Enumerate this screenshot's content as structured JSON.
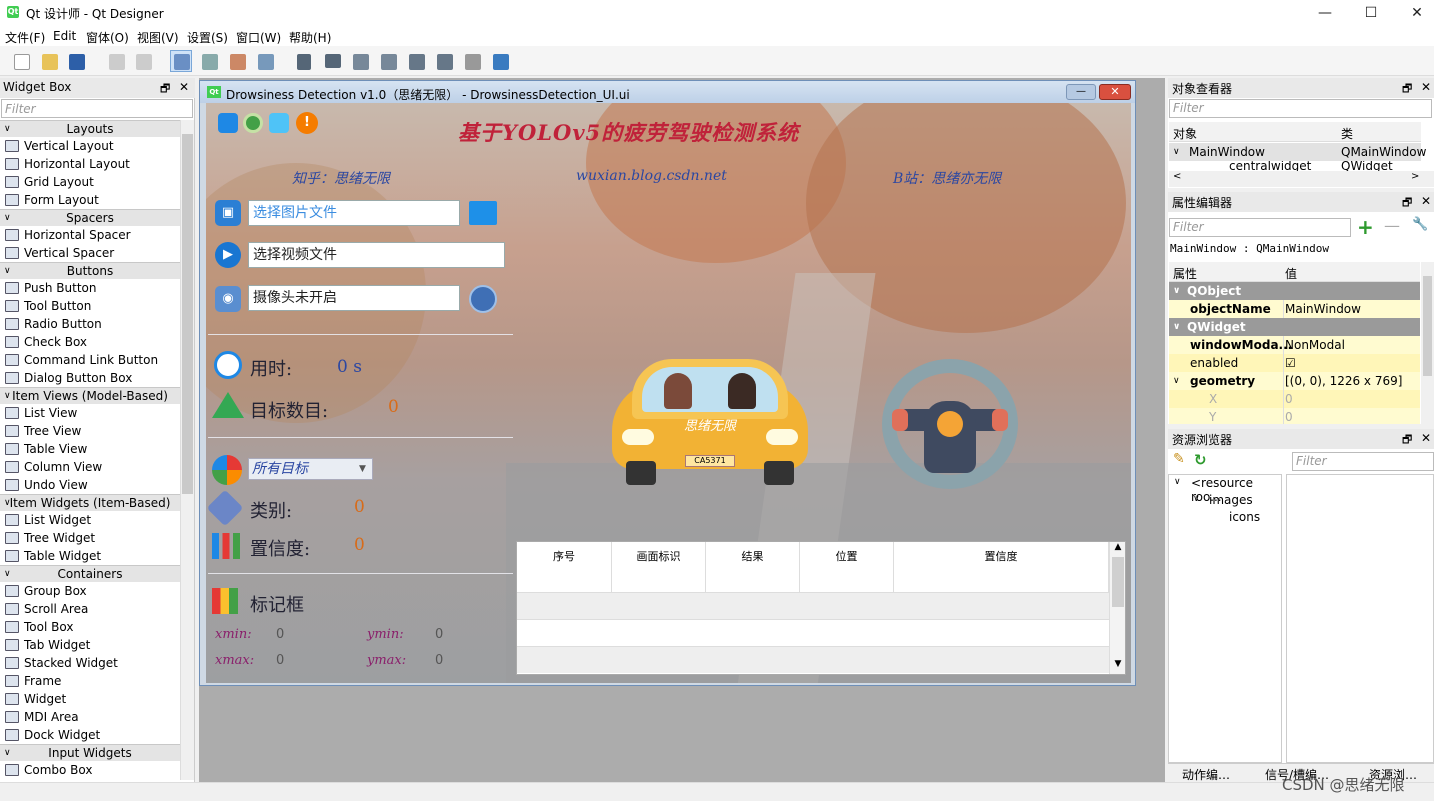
{
  "app": {
    "title": "Qt 设计师 - Qt Designer",
    "icon_text": "Qt"
  },
  "menu": [
    "文件(F)",
    "Edit",
    "窗体(O)",
    "视图(V)",
    "设置(S)",
    "窗口(W)",
    "帮助(H)"
  ],
  "widget_box": {
    "title": "Widget Box",
    "filter_placeholder": "Filter",
    "categories": {
      "layouts": "Layouts",
      "spacers": "Spacers",
      "buttons": "Buttons",
      "item_views": "Item Views (Model-Based)",
      "item_widgets": "Item Widgets (Item-Based)",
      "containers": "Containers",
      "input_widgets": "Input Widgets"
    },
    "items": {
      "layouts": [
        "Vertical Layout",
        "Horizontal Layout",
        "Grid Layout",
        "Form Layout"
      ],
      "spacers": [
        "Horizontal Spacer",
        "Vertical Spacer"
      ],
      "buttons": [
        "Push Button",
        "Tool Button",
        "Radio Button",
        "Check Box",
        "Command Link Button",
        "Dialog Button Box"
      ],
      "item_views": [
        "List View",
        "Tree View",
        "Table View",
        "Column View",
        "Undo View"
      ],
      "item_widgets": [
        "List Widget",
        "Tree Widget",
        "Table Widget"
      ],
      "containers": [
        "Group Box",
        "Scroll Area",
        "Tool Box",
        "Tab Widget",
        "Stacked Widget",
        "Frame",
        "Widget",
        "MDI Area",
        "Dock Widget"
      ],
      "input_widgets": [
        "Combo Box"
      ]
    }
  },
  "form": {
    "window_title": "Drowsiness Detection v1.0（思绪无限） - DrowsinessDetection_UI.ui",
    "heading": "基于YOLOv5的疲劳驾驶检测系统",
    "zhihu": "知乎：思绪无限",
    "blog": "wuxian.blog.csdn.net",
    "bilibili": "B站：思绪亦无限",
    "image_input": "选择图片文件",
    "video_input": "选择视频文件",
    "camera_input": "摄像头未开启",
    "time_label": "用时:",
    "time_value": "0 s",
    "count_label": "目标数目:",
    "count_value": "0",
    "target_select": "所有目标",
    "class_label": "类别:",
    "class_value": "0",
    "conf_label": "置信度:",
    "conf_value": "0",
    "box_label": "标记框",
    "xmin_label": "xmin:",
    "xmin_value": "0",
    "ymin_label": "ymin:",
    "ymin_value": "0",
    "xmax_label": "xmax:",
    "xmax_value": "0",
    "ymax_label": "ymax:",
    "ymax_value": "0",
    "car_plate": "CA5371",
    "car_text": "思绪无限",
    "table_headers": [
      "序号",
      "画面标识",
      "结果",
      "位置",
      "置信度"
    ]
  },
  "object_inspector": {
    "title": "对象查看器",
    "filter_placeholder": "Filter",
    "col_object": "对象",
    "col_class": "类",
    "rows": [
      {
        "object": "MainWindow",
        "class": "QMainWindow"
      },
      {
        "object": "centralwidget",
        "class": "QWidget"
      }
    ]
  },
  "property_editor": {
    "title": "属性编辑器",
    "filter_placeholder": "Filter",
    "context": "MainWindow : QMainWindow",
    "col_property": "属性",
    "col_value": "值",
    "rows": [
      {
        "name": "QObject",
        "value": "",
        "kind": "group"
      },
      {
        "name": "objectName",
        "value": "MainWindow",
        "kind": "bold"
      },
      {
        "name": "QWidget",
        "value": "",
        "kind": "group"
      },
      {
        "name": "windowModa...",
        "value": "NonModal",
        "kind": "bold"
      },
      {
        "name": "enabled",
        "value": "☑",
        "kind": "plain"
      },
      {
        "name": "geometry",
        "value": "[(0, 0), 1226 x 769]",
        "kind": "bold"
      },
      {
        "name": "X",
        "value": "0",
        "kind": "sub"
      },
      {
        "name": "Y",
        "value": "0",
        "kind": "sub"
      }
    ]
  },
  "resource_browser": {
    "title": "资源浏览器",
    "filter_placeholder": "Filter",
    "tree": [
      "<resource roo...",
      "images",
      "icons"
    ]
  },
  "bottom_tabs": [
    "动作编…",
    "信号/槽编…",
    "资源浏…"
  ],
  "watermark": "CSDN @思绪无限",
  "colors": {
    "accent": "#2b7fd4",
    "heading": "#c0223a",
    "value": "#d86b18"
  }
}
